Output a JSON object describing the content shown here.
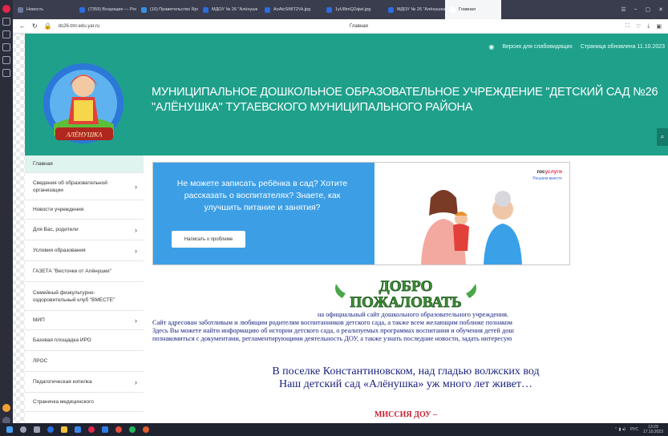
{
  "browser": {
    "tabs": [
      {
        "label": "Новость",
        "color": "#6c7a9c"
      },
      {
        "label": "(7359) Входящие — Рос",
        "color": "#2c6de0"
      },
      {
        "label": "(10) Правительство Яро",
        "color": "#3a8fe0"
      },
      {
        "label": "МДОУ № 26 \"Алёнушк",
        "color": "#2c6de0"
      },
      {
        "label": "AoAtcSMIT2Vk.jpg",
        "color": "#2c6de0"
      },
      {
        "label": "1yU8imQ2ajwi.jpg",
        "color": "#2c6de0"
      },
      {
        "label": "МДОУ № 26 \"Алёнушка",
        "color": "#2c6de0"
      },
      {
        "label": "Главная",
        "color": "#ffffff"
      }
    ],
    "active_tab": "Главная",
    "url": "ds26-tmr.edu.yar.ru",
    "page_title": "Главная"
  },
  "site": {
    "visually_impaired": "Версия для слабовидящих",
    "updated": "Страница обновлена 11.10.2023",
    "title": "МУНИЦИПАЛЬНОЕ ДОШКОЛЬНОЕ ОБРАЗОВАТЕЛЬНОЕ УЧРЕЖДЕНИЕ \"ДЕТСКИЙ САД №26 \"АЛЁНУШКА\" ТУТАЕВСКОГО МУНИЦИПАЛЬНОГО РАЙОНА",
    "logo_text": "АЛЁНУШКА",
    "colors": {
      "header": "#1fa08b",
      "menu_active": "#dff3ef",
      "banner": "#3c9fe6"
    }
  },
  "menu": {
    "items": [
      {
        "label": "Главная",
        "chevron": false,
        "active": true,
        "h": 22
      },
      {
        "label": "Сведения об образовательной организации",
        "chevron": true,
        "active": false,
        "h": 34
      },
      {
        "label": "Новости учреждения",
        "chevron": false,
        "active": false,
        "h": 24
      },
      {
        "label": "Для Вас, родители",
        "chevron": true,
        "active": false,
        "h": 26
      },
      {
        "label": "Условия образования",
        "chevron": true,
        "active": false,
        "h": 26
      },
      {
        "label": "ГАЗЕТА \"Весточки от Алёнушки\"",
        "chevron": false,
        "active": false,
        "h": 26
      },
      {
        "label": "Семейный физкультурно-оздоровительный клуб \"ВМЕСТЕ\"",
        "chevron": false,
        "active": false,
        "h": 36
      },
      {
        "label": "МИП",
        "chevron": true,
        "active": false,
        "h": 24
      },
      {
        "label": "Базовая площадка ИРО",
        "chevron": false,
        "active": false,
        "h": 26
      },
      {
        "label": "ЛРОС",
        "chevron": false,
        "active": false,
        "h": 26
      },
      {
        "label": "Педагогическая копилка",
        "chevron": true,
        "active": false,
        "h": 26
      },
      {
        "label": "Страничка медицинского",
        "chevron": false,
        "active": false,
        "h": 24
      }
    ]
  },
  "banner": {
    "question": "Не можете записать ребёнка в сад? Хотите рассказать о воспитателях? Знаете, как улучшить питание и занятия?",
    "button": "Написать о проблеме",
    "gos_a": "гос",
    "gos_b": "услуги",
    "gos_sub": "Решаем вместе"
  },
  "welcome": {
    "line1": "ДОБРО",
    "line2": "ПОЖАЛОВАТЬ"
  },
  "intro": {
    "line1": "на официальный сайт дошкольного образовательного учреждения.",
    "line2": "Сайт адресован заботливым и любящим родителям воспитанников детского сада, а также всем желающим поближе познаком",
    "line3": "Здесь Вы можете найти информацию об истории детского сада, о реализуемых программах воспитания и обучения детей дош",
    "line4": "познакомиться с документами, регламентирующими деятельность ДОУ, а также узнать последние новости, задать интересую"
  },
  "poem": {
    "line1": "В поселке Константиновском, над гладью волжских вод",
    "line2": "Наш детский сад «Алёнушка» уж много лет живет…"
  },
  "mission": "МИССИЯ ДОУ –",
  "taskbar": {
    "lang": "РУС",
    "time": "13:29",
    "date": "17.10.2023"
  }
}
